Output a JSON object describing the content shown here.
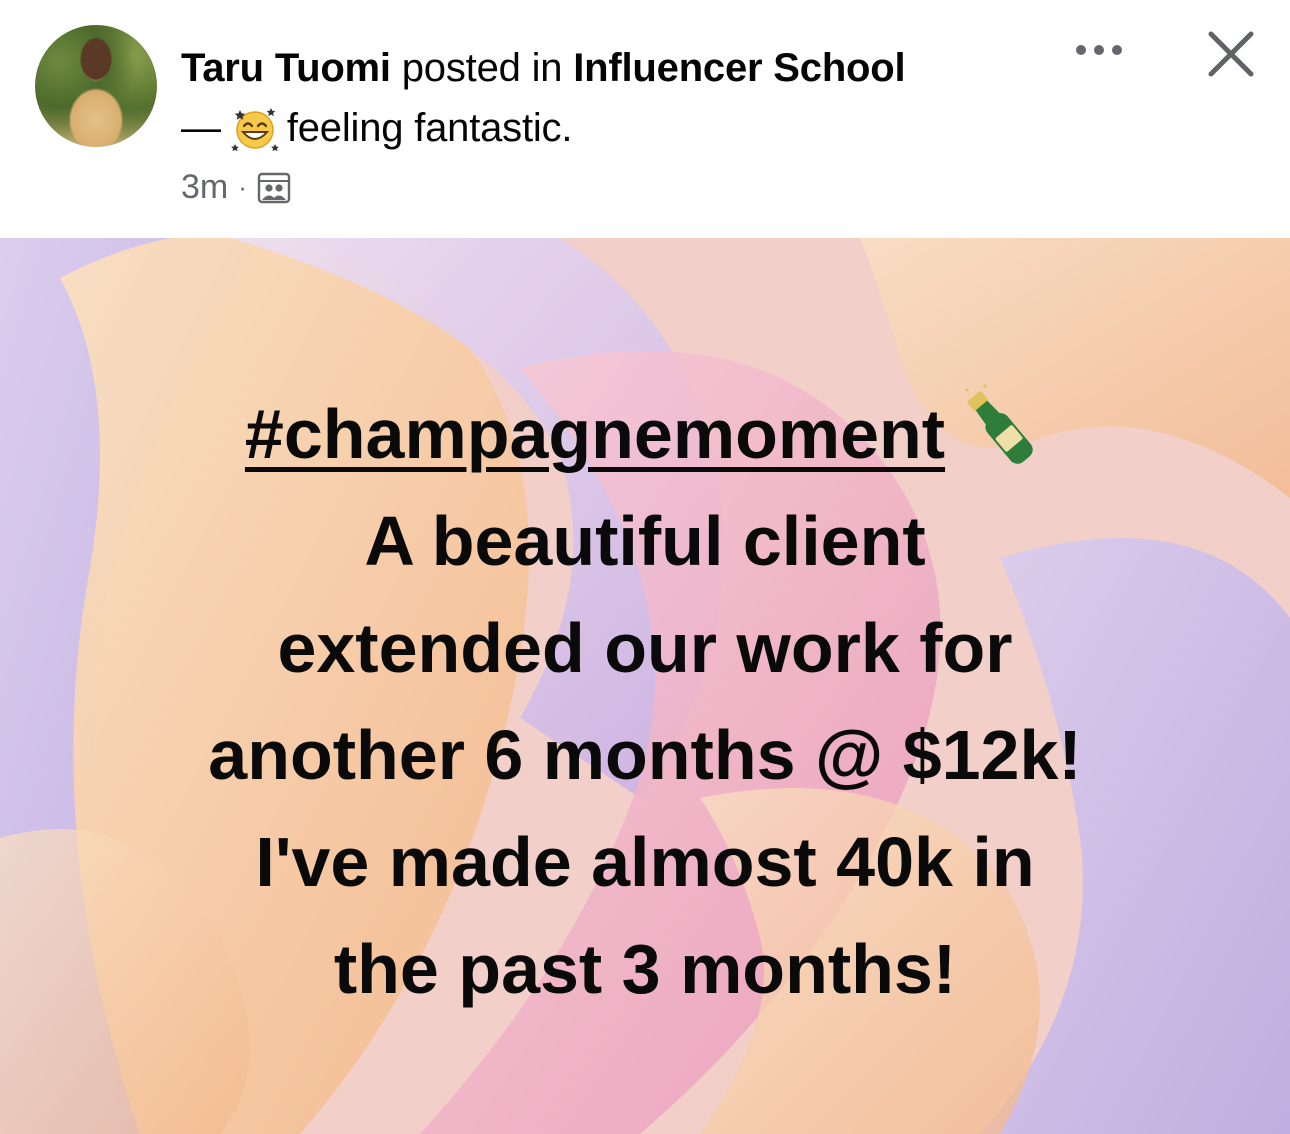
{
  "post": {
    "author": "Taru Tuomi",
    "posted_in": "posted in",
    "group": "Influencer School",
    "dash": "—",
    "feeling": "feeling fantastic.",
    "feeling_icon": "grinning-star-eyes-emoji",
    "time": "3m",
    "separator": "·",
    "audience_icon": "group-audience-icon"
  },
  "actions": {
    "more_icon": "more-options-icon",
    "close_icon": "close-icon"
  },
  "banner": {
    "hashtag": "#champagnemoment",
    "emoji": "champagne-bottle-emoji",
    "lines": [
      "A beautiful client",
      "extended our work for",
      "another 6 months @ $12k!",
      "I've made almost 40k in",
      "the past 3 months!"
    ],
    "colors": {
      "lavender": "#c9b8ec",
      "peach": "#f6c99f",
      "pink": "#eeaac4",
      "cream": "#f8dcc4"
    }
  }
}
